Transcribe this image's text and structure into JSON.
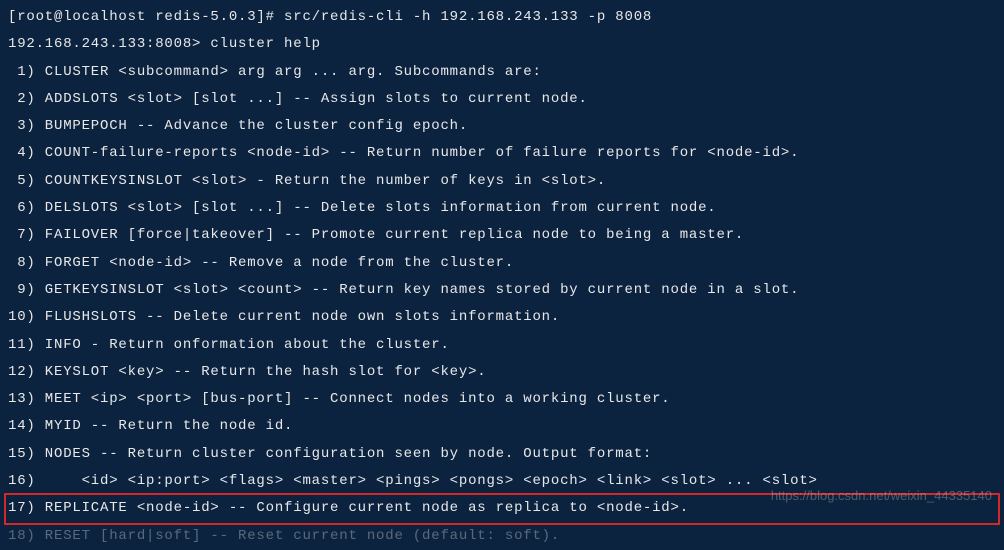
{
  "prompt": "[root@localhost redis-5.0.3]# src/redis-cli -h 192.168.243.133 -p 8008",
  "cli_prompt": "192.168.243.133:8008> cluster help",
  "lines": [
    " 1) CLUSTER <subcommand> arg arg ... arg. Subcommands are:",
    " 2) ADDSLOTS <slot> [slot ...] -- Assign slots to current node.",
    " 3) BUMPEPOCH -- Advance the cluster config epoch.",
    " 4) COUNT-failure-reports <node-id> -- Return number of failure reports for <node-id>.",
    " 5) COUNTKEYSINSLOT <slot> - Return the number of keys in <slot>.",
    " 6) DELSLOTS <slot> [slot ...] -- Delete slots information from current node.",
    " 7) FAILOVER [force|takeover] -- Promote current replica node to being a master.",
    " 8) FORGET <node-id> -- Remove a node from the cluster.",
    " 9) GETKEYSINSLOT <slot> <count> -- Return key names stored by current node in a slot.",
    "10) FLUSHSLOTS -- Delete current node own slots information.",
    "11) INFO - Return onformation about the cluster.",
    "12) KEYSLOT <key> -- Return the hash slot for <key>.",
    "13) MEET <ip> <port> [bus-port] -- Connect nodes into a working cluster.",
    "14) MYID -- Return the node id.",
    "15) NODES -- Return cluster configuration seen by node. Output format:",
    "16)     <id> <ip:port> <flags> <master> <pings> <pongs> <epoch> <link> <slot> ... <slot>",
    "17) REPLICATE <node-id> -- Configure current node as replica to <node-id>.",
    "18) RESET [hard|soft] -- Reset current node (default: soft)."
  ],
  "highlighted_index": 16,
  "watermark": "https://blog.csdn.net/weixin_44335140"
}
